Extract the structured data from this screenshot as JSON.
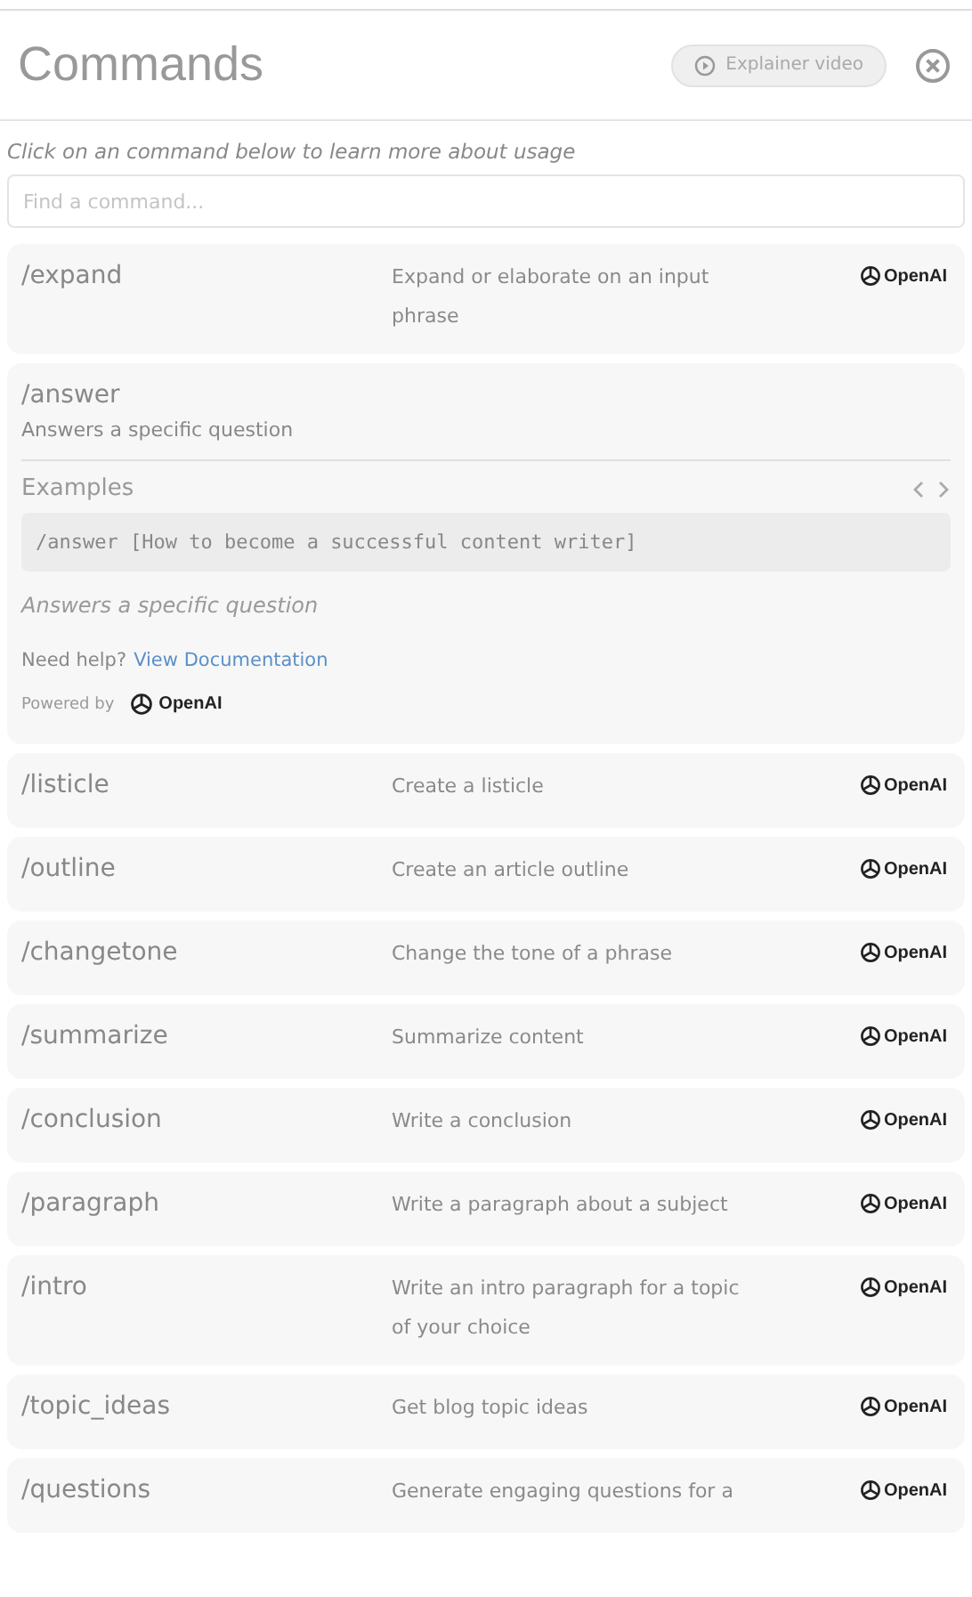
{
  "header": {
    "title": "Commands",
    "video_button": "Explainer video"
  },
  "hint": "Click on an command below to learn more about usage",
  "search": {
    "placeholder": "Find a command..."
  },
  "commands": [
    {
      "kind": "row",
      "command": "/expand",
      "description": "Expand or elaborate on an input phrase",
      "provider": "OpenAI"
    },
    {
      "kind": "expanded",
      "command": "/answer",
      "description": "Answers a specific question",
      "examples_title": "Examples",
      "example": "/answer [How to become a successful content writer]",
      "example_note": "Answers a specific question",
      "help_text": "Need help?",
      "help_link": "View Documentation",
      "powered_by": "Powered by",
      "provider": "OpenAI"
    },
    {
      "kind": "row",
      "command": "/listicle",
      "description": "Create a listicle",
      "provider": "OpenAI"
    },
    {
      "kind": "row",
      "command": "/outline",
      "description": "Create an article outline",
      "provider": "OpenAI"
    },
    {
      "kind": "row",
      "command": "/changetone",
      "description": "Change the tone of a phrase",
      "provider": "OpenAI"
    },
    {
      "kind": "row",
      "command": "/summarize",
      "description": "Summarize content",
      "provider": "OpenAI"
    },
    {
      "kind": "row",
      "command": "/conclusion",
      "description": "Write a conclusion",
      "provider": "OpenAI"
    },
    {
      "kind": "row",
      "command": "/paragraph",
      "description": "Write a paragraph about a subject",
      "provider": "OpenAI"
    },
    {
      "kind": "row",
      "command": "/intro",
      "description": "Write an intro paragraph for a topic of your choice",
      "provider": "OpenAI"
    },
    {
      "kind": "row",
      "command": "/topic_ideas",
      "description": "Get blog topic ideas",
      "provider": "OpenAI"
    },
    {
      "kind": "row",
      "command": "/questions",
      "description": "Generate engaging questions for a",
      "provider": "OpenAI"
    }
  ]
}
